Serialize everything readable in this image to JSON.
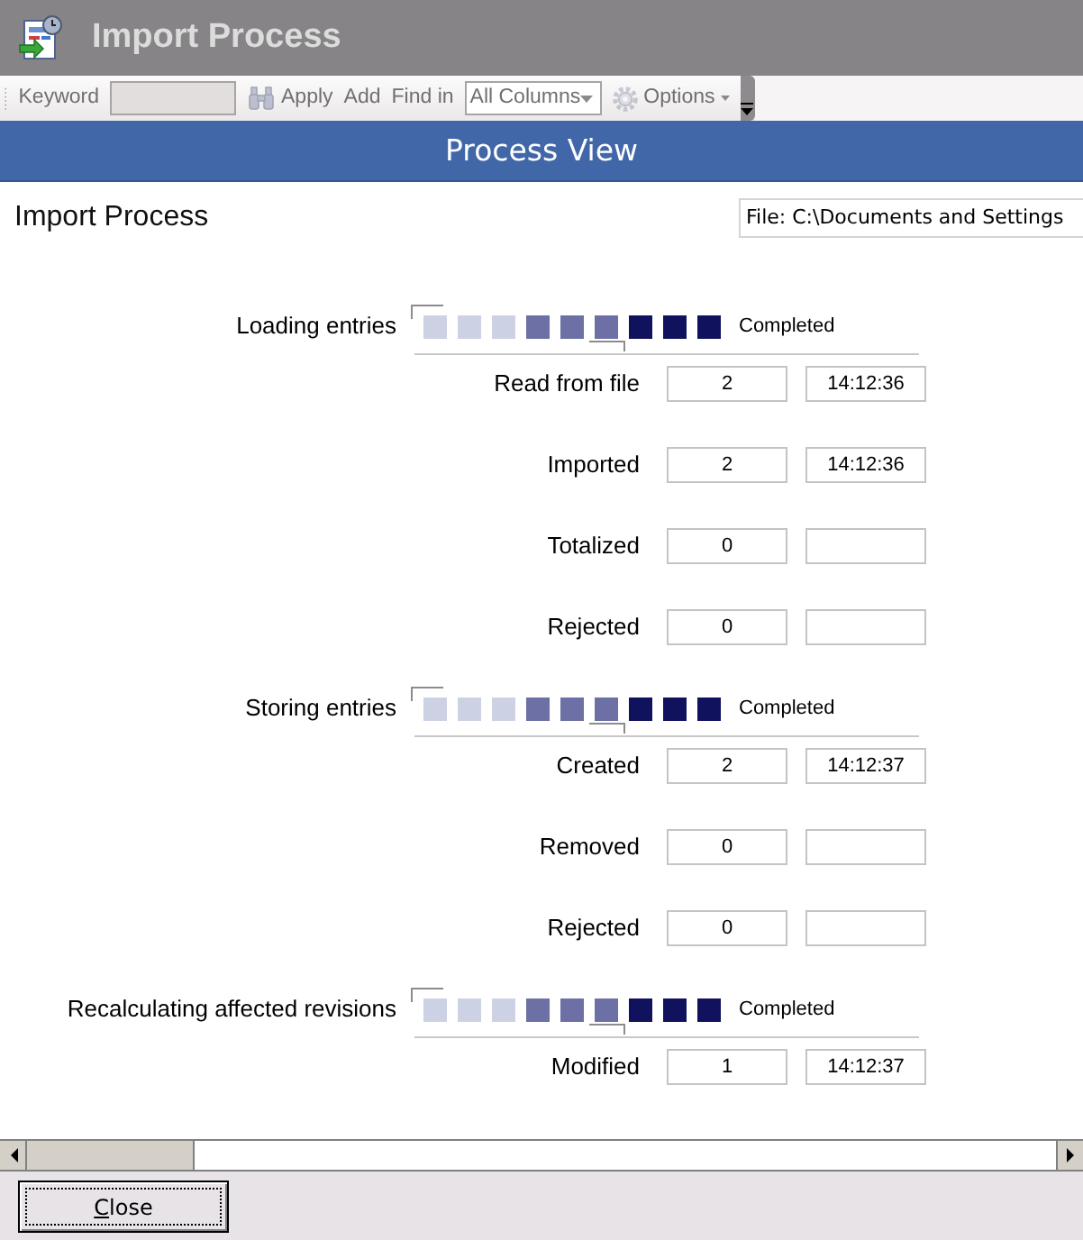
{
  "window": {
    "title": "Import Process"
  },
  "toolbar": {
    "disabled": true,
    "items": [
      {
        "kind": "label",
        "text": "Keyword"
      },
      {
        "kind": "field"
      },
      {
        "kind": "search_button",
        "label": "Apply"
      },
      {
        "kind": "button",
        "label": "Add"
      },
      {
        "kind": "label",
        "text": "Find in"
      },
      {
        "kind": "dropdown",
        "value": "All Columns"
      },
      {
        "kind": "menu_button",
        "label": "Options"
      }
    ]
  },
  "header": {
    "title": "Process View"
  },
  "process": {
    "title": "Import Process",
    "file_field": {
      "value": "File: C:\\Documents and Settings"
    }
  },
  "stages": [
    {
      "label": "Loading entries",
      "status": "Completed",
      "rows": [
        {
          "label": "Read from file",
          "count": "2",
          "time": "14:12:36"
        },
        {
          "label": "Imported",
          "count": "2",
          "time": "14:12:36"
        },
        {
          "label": "Totalized",
          "count": "0"
        },
        {
          "label": "Rejected",
          "count": "0"
        }
      ]
    },
    {
      "label": "Storing entries",
      "status": "Completed",
      "rows": [
        {
          "label": "Created",
          "count": "2",
          "time": "14:12:37"
        },
        {
          "label": "Removed",
          "count": "0"
        },
        {
          "label": "Rejected",
          "count": "0"
        }
      ]
    },
    {
      "label": "Recalculating affected revisions",
      "status": "Completed",
      "rows": [
        {
          "label": "Modified",
          "count": "1",
          "time": "14:12:37"
        }
      ]
    }
  ],
  "footer": {
    "buttons": [
      {
        "label": "Close",
        "focused": true
      }
    ]
  }
}
